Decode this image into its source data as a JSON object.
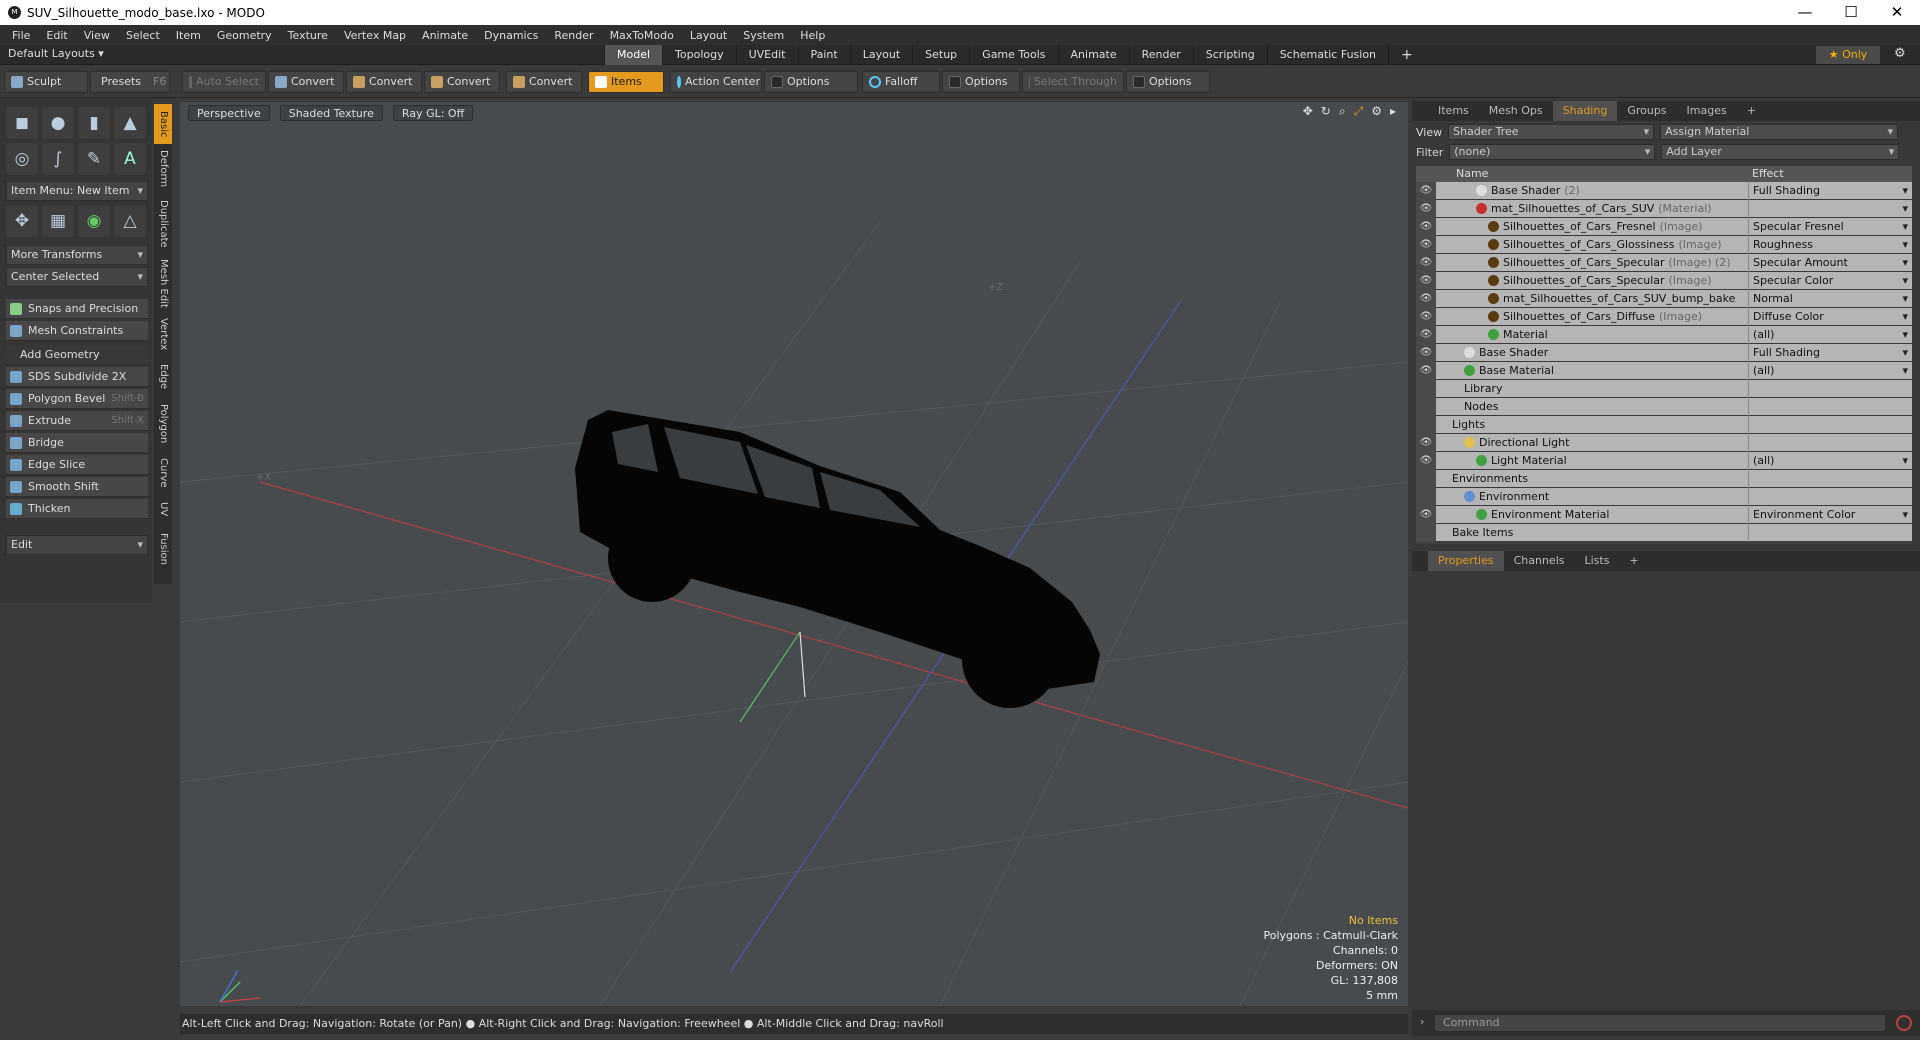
{
  "window": {
    "title": "SUV_Silhouette_modo_base.lxo - MODO",
    "minimize": "—",
    "maximize": "☐",
    "close": "✕"
  },
  "menu": [
    "File",
    "Edit",
    "View",
    "Select",
    "Item",
    "Geometry",
    "Texture",
    "Vertex Map",
    "Animate",
    "Dynamics",
    "Render",
    "MaxToModo",
    "Layout",
    "System",
    "Help"
  ],
  "layout": {
    "default_layouts": "Default Layouts ▾",
    "tabs": [
      "Model",
      "Topology",
      "UVEdit",
      "Paint",
      "Layout",
      "Setup",
      "Game Tools",
      "Animate",
      "Render",
      "Scripting",
      "Schematic Fusion"
    ],
    "active_tab": "Model",
    "add": "+",
    "only": "★ Only"
  },
  "toolbar": {
    "sculpt": "Sculpt",
    "presets": "Presets",
    "presets_key": "F6",
    "auto_select": "Auto Select",
    "convert": "Convert",
    "items": "Items",
    "action_center": "Action Center",
    "options": "Options",
    "falloff": "Falloff",
    "select_through": "Select Through"
  },
  "left_panel": {
    "item_menu": "Item Menu: New Item",
    "more_transforms": "More Transforms",
    "center_selected": "Center Selected",
    "snaps": "Snaps and Precision",
    "mesh_constraints": "Mesh Constraints",
    "add_geometry": "Add Geometry",
    "tools": [
      {
        "label": "SDS Subdivide 2X",
        "shortcut": ""
      },
      {
        "label": "Polygon Bevel",
        "shortcut": "Shift-B"
      },
      {
        "label": "Extrude",
        "shortcut": "Shift-X"
      },
      {
        "label": "Bridge",
        "shortcut": ""
      },
      {
        "label": "Edge Slice",
        "shortcut": ""
      },
      {
        "label": "Smooth Shift",
        "shortcut": ""
      },
      {
        "label": "Thicken",
        "shortcut": ""
      }
    ],
    "edit": "Edit",
    "vertical_tabs": [
      "Basic",
      "Deform",
      "Duplicate",
      "Mesh Edit",
      "Vertex",
      "Edge",
      "Polygon",
      "Curve",
      "UV",
      "Fusion"
    ]
  },
  "viewport": {
    "perspective": "Perspective",
    "shaded_texture": "Shaded Texture",
    "raygl": "Ray GL: Off",
    "axis_z": "+Z",
    "axis_x": "+X",
    "info": {
      "no_items": "No Items",
      "polygons": "Polygons : Catmull-Clark",
      "channels": "Channels: 0",
      "deformers": "Deformers: ON",
      "gl": "GL: 137,808",
      "scale": "5 mm"
    }
  },
  "status": "Alt-Left Click and Drag: Navigation: Rotate (or Pan) ● Alt-Right Click and Drag: Navigation: Freewheel ● Alt-Middle Click and Drag: navRoll",
  "right_panel": {
    "tabs": [
      "Items",
      "Mesh Ops",
      "Shading",
      "Groups",
      "Images"
    ],
    "active_tab": "Shading",
    "view_label": "View",
    "view_value": "Shader Tree",
    "assign_material": "Assign Material",
    "filter_label": "Filter",
    "filter_value": "(none)",
    "add_layer": "Add Layer",
    "col_name": "Name",
    "col_effect": "Effect",
    "tree": [
      {
        "name": "Base Shader",
        "sub": "(2)",
        "effect": "Full Shading",
        "indent": 3,
        "icon": "#dddddd",
        "eye": true,
        "dd": true
      },
      {
        "name": "mat_Silhouettes_of_Cars_SUV",
        "sub": "(Material)",
        "effect": "",
        "indent": 3,
        "icon": "#c83030",
        "eye": true,
        "dd": true
      },
      {
        "name": "Silhouettes_of_Cars_Fresnel",
        "sub": "(Image)",
        "effect": "Specular Fresnel",
        "indent": 4,
        "icon": "#5a3a10",
        "eye": true,
        "dd": true
      },
      {
        "name": "Silhouettes_of_Cars_Glossiness",
        "sub": "(Image)",
        "effect": "Roughness",
        "indent": 4,
        "icon": "#5a3a10",
        "eye": true,
        "dd": true
      },
      {
        "name": "Silhouettes_of_Cars_Specular",
        "sub": "(Image) (2)",
        "effect": "Specular Amount",
        "indent": 4,
        "icon": "#5a3a10",
        "eye": true,
        "dd": true
      },
      {
        "name": "Silhouettes_of_Cars_Specular",
        "sub": "(Image)",
        "effect": "Specular Color",
        "indent": 4,
        "icon": "#5a3a10",
        "eye": true,
        "dd": true
      },
      {
        "name": "mat_Silhouettes_of_Cars_SUV_bump_bake ...",
        "sub": "",
        "effect": "Normal",
        "indent": 4,
        "icon": "#5a3a10",
        "eye": true,
        "dd": true
      },
      {
        "name": "Silhouettes_of_Cars_Diffuse",
        "sub": "(Image)",
        "effect": "Diffuse Color",
        "indent": 4,
        "icon": "#5a3a10",
        "eye": true,
        "dd": true
      },
      {
        "name": "Material",
        "sub": "",
        "effect": "(all)",
        "indent": 4,
        "icon": "#40a040",
        "eye": true,
        "dd": true
      },
      {
        "name": "Base Shader",
        "sub": "",
        "effect": "Full Shading",
        "indent": 2,
        "icon": "#dddddd",
        "eye": true,
        "dd": true
      },
      {
        "name": "Base Material",
        "sub": "",
        "effect": "(all)",
        "indent": 2,
        "icon": "#40a040",
        "eye": true,
        "dd": true
      },
      {
        "name": "Library",
        "sub": "",
        "effect": "",
        "indent": 2,
        "icon": "",
        "eye": false,
        "dd": false
      },
      {
        "name": "Nodes",
        "sub": "",
        "effect": "",
        "indent": 2,
        "icon": "",
        "eye": false,
        "dd": false
      },
      {
        "name": "Lights",
        "sub": "",
        "effect": "",
        "indent": 1,
        "icon": "",
        "eye": false,
        "dd": false
      },
      {
        "name": "Directional Light",
        "sub": "",
        "effect": "",
        "indent": 2,
        "icon": "#e0c050",
        "eye": true,
        "dd": false
      },
      {
        "name": "Light Material",
        "sub": "",
        "effect": "(all)",
        "indent": 3,
        "icon": "#40a040",
        "eye": true,
        "dd": true
      },
      {
        "name": "Environments",
        "sub": "",
        "effect": "",
        "indent": 1,
        "icon": "",
        "eye": false,
        "dd": false
      },
      {
        "name": "Environment",
        "sub": "",
        "effect": "",
        "indent": 2,
        "icon": "#6090d0",
        "eye": false,
        "dd": false
      },
      {
        "name": "Environment Material",
        "sub": "",
        "effect": "Environment Color",
        "indent": 3,
        "icon": "#40a040",
        "eye": true,
        "dd": true
      },
      {
        "name": "Bake Items",
        "sub": "",
        "effect": "",
        "indent": 1,
        "icon": "",
        "eye": false,
        "dd": false
      }
    ],
    "props_tabs": [
      "Properties",
      "Channels",
      "Lists"
    ],
    "props_active": "Properties",
    "command_placeholder": "Command"
  },
  "colors": {
    "accent": "#e39a1f",
    "viewport_bg": "#484b4e",
    "tree_row": "#b5b5b5"
  }
}
